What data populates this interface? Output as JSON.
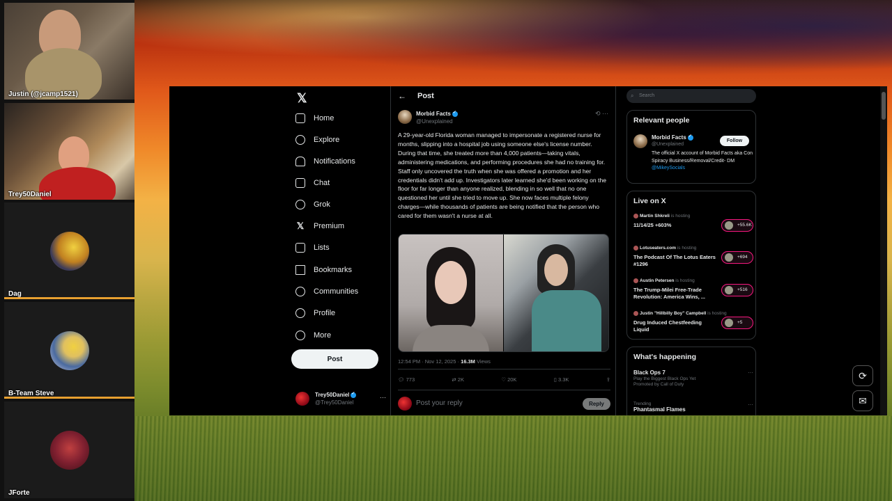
{
  "stream": {
    "participants": [
      {
        "name": "Justin (@jcamp1521)"
      },
      {
        "name": "Trey50Daniel"
      },
      {
        "name": "Dag"
      },
      {
        "name": "B-Team Steve"
      },
      {
        "name": "JForte"
      }
    ]
  },
  "x_nav": {
    "logo": "𝕏",
    "items": [
      {
        "label": "Home",
        "icon": "home-icon"
      },
      {
        "label": "Explore",
        "icon": "search-icon"
      },
      {
        "label": "Notifications",
        "icon": "bell-icon"
      },
      {
        "label": "Chat",
        "icon": "mail-icon"
      },
      {
        "label": "Grok",
        "icon": "grok-icon"
      },
      {
        "label": "Premium",
        "icon": "x-icon"
      },
      {
        "label": "Lists",
        "icon": "list-icon"
      },
      {
        "label": "Bookmarks",
        "icon": "bookmark-icon"
      },
      {
        "label": "Communities",
        "icon": "people-icon"
      },
      {
        "label": "Profile",
        "icon": "person-icon"
      },
      {
        "label": "More",
        "icon": "more-circle-icon"
      }
    ],
    "post_button": "Post",
    "account": {
      "name": "Trey50Daniel",
      "handle": "@Trey50Daniel",
      "more": "···"
    }
  },
  "post": {
    "header": "Post",
    "back": "←",
    "author": {
      "name": "Morbid Facts",
      "handle": "@Unexplained"
    },
    "top_actions": "⟲  ···",
    "text": "A 29-year-old Florida woman managed to impersonate a registered nurse for months, slipping into a hospital job using someone else's license number. During that time, she treated more than 4,000 patients—taking vitals, administering medications, and performing procedures she had no training for. Staff only uncovered the truth when she was offered a promotion and her credentials didn't add up. Investigators later learned she'd been working on the floor for far longer than anyone realized, blending in so well that no one questioned her until she tried to move up. She now faces multiple felony charges—while thousands of patients are being notified that the person who cared for them wasn't a nurse at all.",
    "timestamp": "12:54 PM · Nov 12, 2025 · ",
    "views_count": "16.3M",
    "views_label": " Views",
    "replies": "773",
    "reposts": "2K",
    "likes": "20K",
    "bookmarks": "3.3K",
    "reply_placeholder": "Post your reply",
    "reply_button": "Reply"
  },
  "sidebar": {
    "search_placeholder": "Search",
    "relevant_title": "Relevant people",
    "relevant": {
      "name": "Morbid Facts",
      "handle": "@Unexplained",
      "follow": "Follow",
      "bio": "The official X account of Morbid Facts aka Con Spiracy Business/Removal/Credit- DM ",
      "bio_link": "@MikeySocials"
    },
    "live_title": "Live on X",
    "live": [
      {
        "host": "Martin Shkreli",
        "status": " is hosting",
        "title": "11/14/25 +603%",
        "count": "+55.6K"
      },
      {
        "host": "Lotuseaters.com",
        "status": " is hosting",
        "title": "The Podcast Of The Lotus Eaters #1296",
        "count": "+694"
      },
      {
        "host": "Austin Petersen",
        "status": " is hosting",
        "title": "The Trump-Milei Free-Trade Revolution: America Wins, ...",
        "count": "+516"
      },
      {
        "host": "Justin \"Hillbilly Boy\" Campbell",
        "status": " is hosting",
        "title": "Drug Induced Chestfeeding Liquid",
        "count": "+5"
      }
    ],
    "happening_title": "What's happening",
    "trends": [
      {
        "top": "",
        "name": "Black Ops 7",
        "sub": "Play the Biggest Black Ops Yet",
        "promo": "Promoted by Call of Duty"
      },
      {
        "top": "Trending",
        "name": "Phantasmal Flames",
        "sub": "",
        "promo": ""
      }
    ]
  },
  "colors": {
    "accent": "#1d9bf0",
    "live_pink": "#f91880",
    "background": "#000000",
    "text": "#e7e9ea",
    "muted": "#71767b"
  }
}
